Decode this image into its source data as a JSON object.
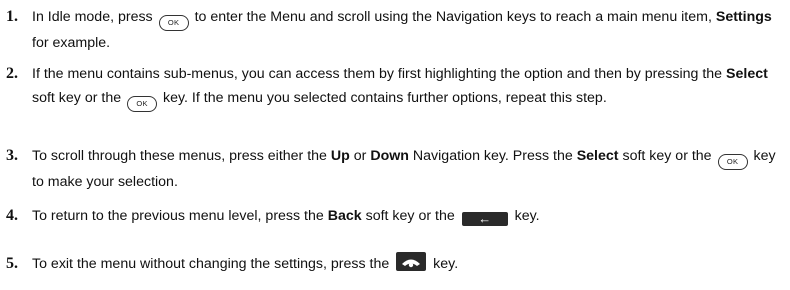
{
  "steps": [
    {
      "number": "1.",
      "a": "In Idle mode, press",
      "b": "to enter the Menu and scroll using the Navigation keys to reach a main menu item,",
      "c": "Settings",
      "d": "for example."
    },
    {
      "number": "2.",
      "a": "If the menu contains sub-menus, you can access them by first highlighting the option and then by pressing the",
      "b": "Select",
      "c": "soft key or the",
      "d": "key. If the menu you selected contains further options, repeat this step."
    },
    {
      "number": "3.",
      "a": "To scroll through these menus, press either the",
      "b": "Up",
      "c": "or",
      "d": "Down",
      "e": "Navigation key. Press the",
      "f": "Select",
      "g": "soft key or the",
      "h": "key to make your selection."
    },
    {
      "number": "4.",
      "a": "To return to the previous menu level, press the",
      "b": "Back",
      "c": "soft key or the",
      "d": "key."
    },
    {
      "number": "5.",
      "a": "To exit the menu without changing the settings, press the",
      "b": "key."
    }
  ],
  "keys": {
    "ok": "OK",
    "back": "←",
    "end_icon": "end-key-icon"
  }
}
